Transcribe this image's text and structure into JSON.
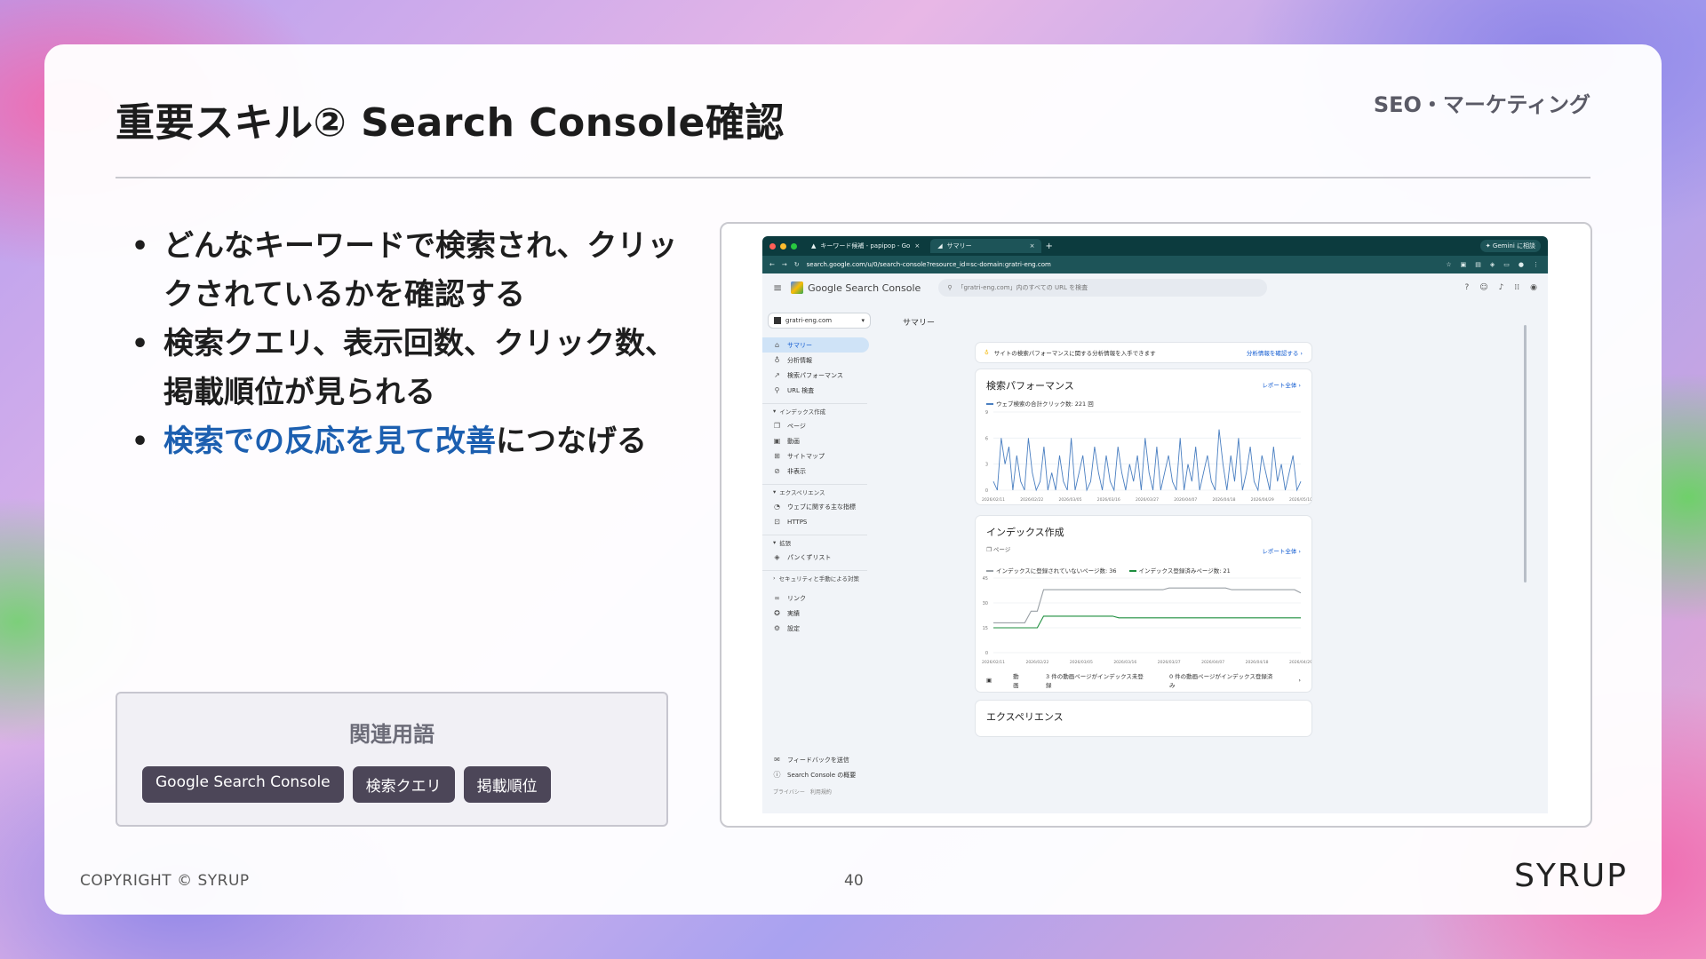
{
  "slide": {
    "title": "重要スキル② Search Console確認",
    "category": "SEO・マーケティング",
    "bullets": {
      "b1": "どんなキーワードで検索され、クリックされているかを確認する",
      "b2": "検索クエリ、表示回数、クリック数、掲載順位が見られる",
      "b3_highlight": "検索での反応を見て改善",
      "b3_rest": "につなげる"
    },
    "related_terms": {
      "title": "関連用語",
      "tags": [
        "Google Search Console",
        "検索クエリ",
        "掲載順位"
      ]
    },
    "footer": {
      "copyright": "COPYRIGHT © SYRUP",
      "page_number": "40",
      "logo": "SYRUP"
    },
    "colors": {
      "highlight": "#1c5fb0",
      "tag_bg": "#4c4658"
    }
  },
  "screenshot": {
    "browser": {
      "tab1": "キーワード候補 - papipop - Go",
      "tab2": "サマリー",
      "new_tab": "+",
      "gemini": "Gemini に相談",
      "address": "search.google.com/u/0/search-console?resource_id=sc-domain:gratri-eng.com"
    },
    "gsc": {
      "brand": "Google Search Console",
      "search_placeholder": "「gratri-eng.com」内のすべての URL を検査",
      "property": "gratri-eng.com",
      "nav": {
        "summary": "サマリー",
        "insights": "分析情報",
        "performance": "検索パフォーマンス",
        "url_inspection": "URL 検査",
        "group_indexing": "インデックス作成",
        "pages": "ページ",
        "videos": "動画",
        "sitemaps": "サイトマップ",
        "removals": "非表示",
        "group_experience": "エクスペリエンス",
        "web_vitals": "ウェブに関する主な指標",
        "https": "HTTPS",
        "group_enhancements": "拡張",
        "breadcrumbs": "パンくずリスト",
        "group_security": "セキュリティと手動による対策",
        "links": "リンク",
        "achievements": "実績",
        "settings": "設定",
        "feedback": "フィードバックを送信",
        "about": "Search Console の概要",
        "privacy": "プライバシー",
        "terms": "利用規約"
      },
      "page_title": "サマリー",
      "tip_text": "サイトの検索パフォーマンスに関する分析情報を入手できます",
      "tip_link": "分析情報を確認する",
      "perf_card": {
        "title": "検索パフォーマンス",
        "link": "レポート全体",
        "legend": "ウェブ検索の合計クリック数: 221 回"
      },
      "index_card": {
        "title": "インデックス作成",
        "sub": "ページ",
        "link": "レポート全体",
        "legend_not": "インデックスに登録されていないページ数: 36",
        "legend_yes": "インデックス登録済みページ数: 21",
        "video_label": "動画",
        "video_not": "3 件の動画ページがインデックス未登録",
        "video_yes": "0 件の動画ページがインデックス登録済み"
      },
      "exp_card": {
        "title": "エクスペリエンス"
      }
    },
    "chart_data": [
      {
        "type": "line",
        "title": "検索パフォーマンス",
        "x_ticks": [
          "2026/02/11",
          "2026/02/22",
          "2026/03/05",
          "2026/03/16",
          "2026/03/27",
          "2026/04/07",
          "2026/04/18",
          "2026/04/29",
          "2026/05/10"
        ],
        "y_ticks": [
          0,
          3,
          6,
          9
        ],
        "ylim": [
          0,
          9
        ],
        "series": [
          {
            "name": "ウェブ検索の合計クリック数: 221 回",
            "color": "#4a7fc1",
            "values": [
              1,
              0,
              6,
              3,
              5,
              0,
              4,
              1,
              0,
              6,
              2,
              0,
              1,
              5,
              0,
              2,
              0,
              4,
              1,
              0,
              6,
              0,
              2,
              4,
              0,
              1,
              5,
              2,
              0,
              4,
              1,
              0,
              5,
              2,
              0,
              3,
              1,
              4,
              0,
              6,
              2,
              0,
              5,
              0,
              2,
              4,
              1,
              0,
              6,
              0,
              3,
              1,
              5,
              0,
              2,
              4,
              1,
              0,
              7,
              3,
              0,
              4,
              1,
              6,
              0,
              2,
              5,
              1,
              0,
              4,
              2,
              0,
              5,
              1,
              3,
              0,
              2,
              4,
              0,
              1
            ]
          }
        ]
      },
      {
        "type": "line",
        "title": "インデックス作成",
        "x_ticks": [
          "2026/02/11",
          "2026/02/22",
          "2026/03/05",
          "2026/03/16",
          "2026/03/27",
          "2026/04/07",
          "2026/04/18",
          "2026/04/29"
        ],
        "y_ticks": [
          0,
          15,
          30,
          45
        ],
        "ylim": [
          0,
          45
        ],
        "series": [
          {
            "name": "インデックスに登録されていないページ数: 36",
            "color": "#9aa0a6",
            "values": [
              18,
              18,
              18,
              18,
              18,
              18,
              25,
              25,
              38,
              38,
              38,
              38,
              38,
              38,
              38,
              38,
              38,
              38,
              38,
              38,
              38,
              38,
              38,
              38,
              38,
              38,
              38,
              38,
              39,
              39,
              39,
              39,
              39,
              39,
              39,
              39,
              39,
              39,
              38,
              38,
              38,
              38,
              38,
              38,
              38,
              38,
              38,
              38,
              38,
              36
            ]
          },
          {
            "name": "インデックス登録済みページ数: 21",
            "color": "#1e8e3e",
            "values": [
              15,
              15,
              15,
              15,
              15,
              15,
              15,
              15,
              22,
              22,
              22,
              22,
              22,
              22,
              22,
              22,
              22,
              22,
              22,
              22,
              21,
              21,
              21,
              21,
              21,
              21,
              21,
              21,
              21,
              21,
              21,
              21,
              21,
              21,
              21,
              21,
              21,
              21,
              21,
              21,
              21,
              21,
              21,
              21,
              21,
              21,
              21,
              21,
              21,
              21
            ]
          }
        ]
      }
    ]
  }
}
